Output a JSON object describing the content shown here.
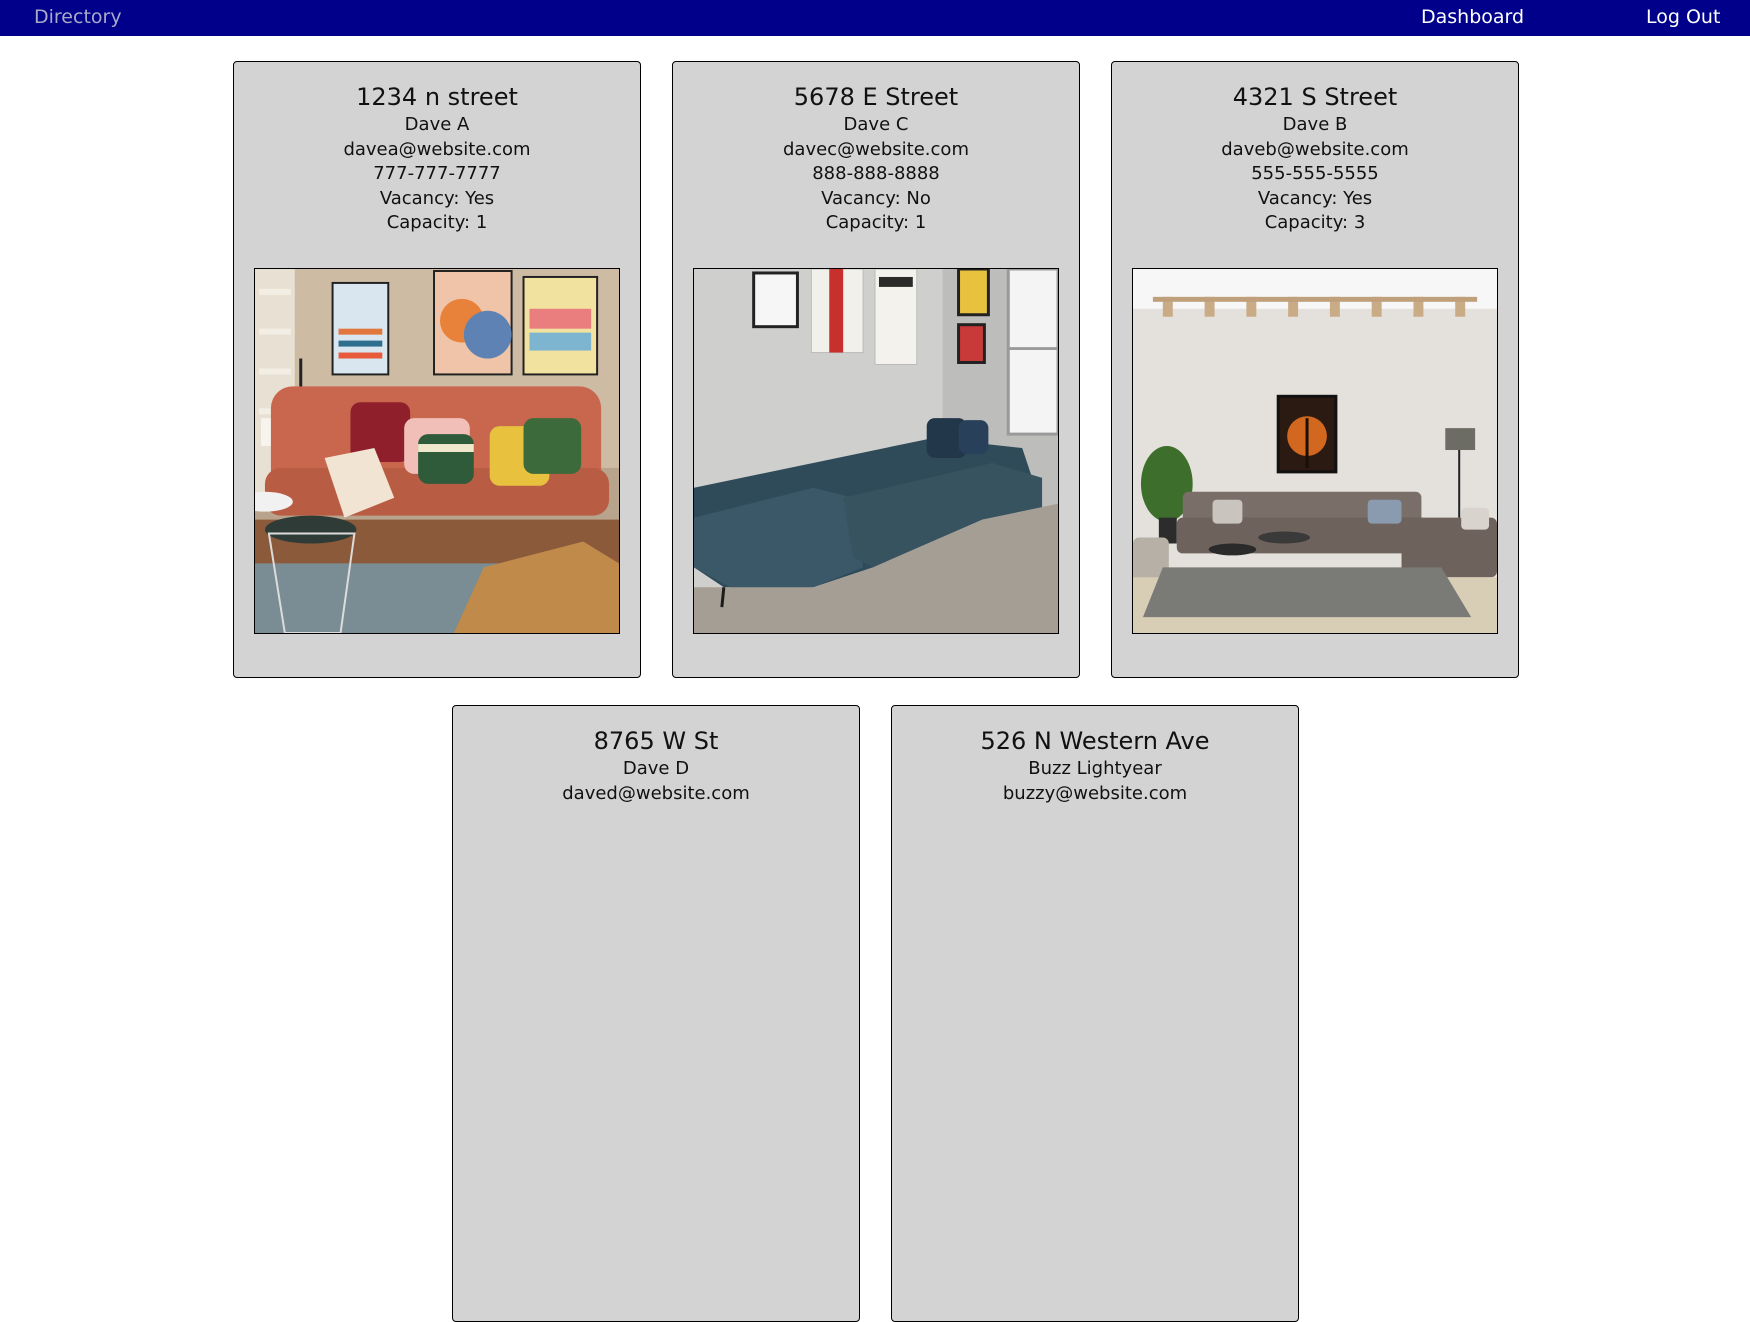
{
  "nav": {
    "brand": "Directory",
    "dashboard": "Dashboard",
    "logout": "Log Out"
  },
  "listings": [
    {
      "address": "1234 n street",
      "owner": "Dave A",
      "email": "davea@website.com",
      "phone": "777-777-7777",
      "vacancy": "Vacancy: Yes",
      "capacity": "Capacity: 1",
      "photo": "living-room-orange-sofa"
    },
    {
      "address": "5678 E Street",
      "owner": "Dave C",
      "email": "davec@website.com",
      "phone": "888-888-8888",
      "vacancy": "Vacancy: No",
      "capacity": "Capacity: 1",
      "photo": "living-room-blue-sofa"
    },
    {
      "address": "4321 S Street",
      "owner": "Dave B",
      "email": "daveb@website.com",
      "phone": "555-555-5555",
      "vacancy": "Vacancy: Yes",
      "capacity": "Capacity: 3",
      "photo": "living-room-gray-sofa"
    },
    {
      "address": "8765 W St",
      "owner": "Dave D",
      "email": "daved@website.com"
    },
    {
      "address": "526 N Western Ave",
      "owner": "Buzz Lightyear",
      "email": "buzzy@website.com"
    }
  ],
  "colors": {
    "navbar": "#00008b",
    "card": "#d3d3d3",
    "brand_text": "#a9a9c8"
  }
}
